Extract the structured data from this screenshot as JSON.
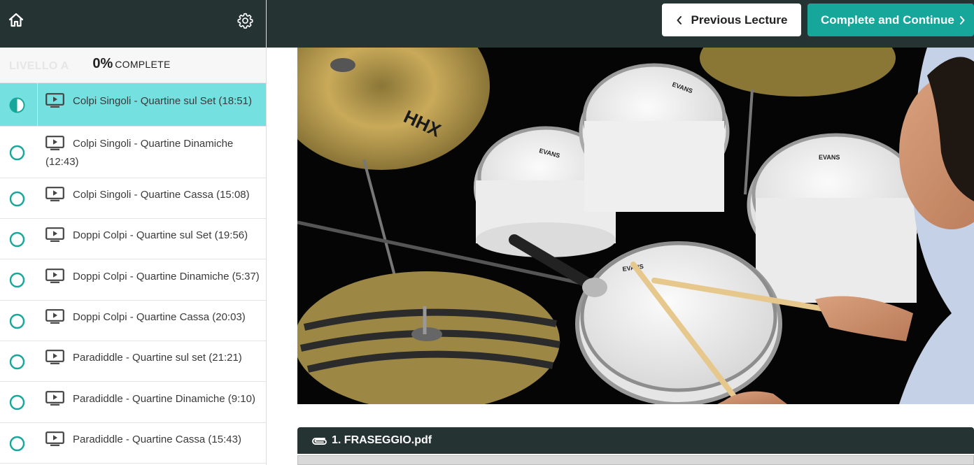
{
  "sidebar": {
    "course_ghost": "LIVELLO A",
    "progress_percent": "0%",
    "progress_label": "complete",
    "icons": {
      "home": "home-icon",
      "settings": "gear-icon"
    },
    "lectures": [
      {
        "title": "Colpi Singoli - Quartine sul Set (18:51)",
        "status": "in-progress",
        "active": true
      },
      {
        "title": "Colpi Singoli - Quartine Dinamiche (12:43)",
        "status": "not-started",
        "active": false
      },
      {
        "title": "Colpi Singoli - Quartine Cassa (15:08)",
        "status": "not-started",
        "active": false
      },
      {
        "title": "Doppi Colpi - Quartine sul Set (19:56)",
        "status": "not-started",
        "active": false
      },
      {
        "title": "Doppi Colpi - Quartine Dinamiche (5:37)",
        "status": "not-started",
        "active": false
      },
      {
        "title": "Doppi Colpi - Quartine Cassa (20:03)",
        "status": "not-started",
        "active": false
      },
      {
        "title": "Paradiddle - Quartine sul set (21:21)",
        "status": "not-started",
        "active": false
      },
      {
        "title": "Paradiddle - Quartine Dinamiche (9:10)",
        "status": "not-started",
        "active": false
      },
      {
        "title": "Paradiddle - Quartine Cassa (15:43)",
        "status": "not-started",
        "active": false
      }
    ]
  },
  "topbar": {
    "previous_label": "Previous Lecture",
    "next_label": "Complete and Continue"
  },
  "attachment": {
    "label": "1. FRASEGGIO.pdf",
    "icon": "paperclip-icon"
  },
  "colors": {
    "header_bg": "#263333",
    "accent_teal": "#17a69a",
    "active_row": "#74e0e0",
    "status_ring": "#17a69a"
  }
}
